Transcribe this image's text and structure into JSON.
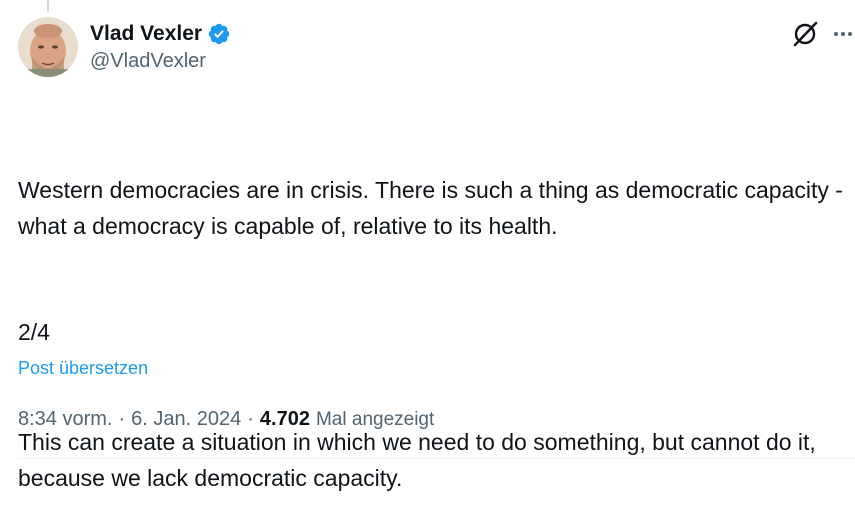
{
  "author": {
    "display_name": "Vlad Vexler",
    "handle": "@VladVexler",
    "verified": true
  },
  "tweet": {
    "paragraph_1": "Western democracies are in crisis. There is such a thing as democratic capacity - what a democracy is capable of, relative to its health.",
    "paragraph_2": "This can create a situation in which we need to do something, but cannot do it, because we lack democratic capacity.",
    "counter": "2/4",
    "translate_label": "Post übersetzen"
  },
  "meta": {
    "time": "8:34 vorm.",
    "separator": "·",
    "date": "6. Jan. 2024",
    "views_count": "4.702",
    "views_label": "Mal angezeigt"
  },
  "icons": {
    "verified": "verified-badge-icon",
    "grok": "grok-icon",
    "more": "more-horizontal-icon"
  },
  "colors": {
    "accent": "#1d9bf0",
    "text_primary": "#0f1419",
    "text_secondary": "#536471"
  }
}
